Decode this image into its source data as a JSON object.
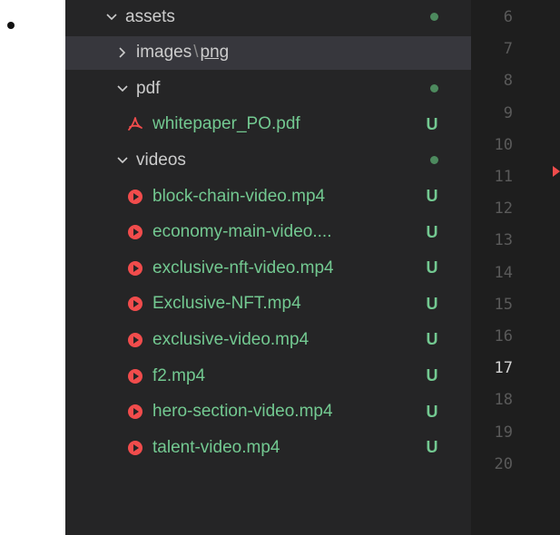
{
  "explorer": {
    "rows": [
      {
        "kind": "folder",
        "label": "assets",
        "expanded": true,
        "status": "dot"
      },
      {
        "kind": "folder",
        "label_parts": [
          "images",
          "png"
        ],
        "expanded": false,
        "selected": true
      },
      {
        "kind": "folder",
        "label": "pdf",
        "expanded": true,
        "status": "dot"
      },
      {
        "kind": "pdf",
        "label": "whitepaper_PO.pdf",
        "status": "U"
      },
      {
        "kind": "folder",
        "label": "videos",
        "expanded": true,
        "status": "dot"
      },
      {
        "kind": "video",
        "label": "block-chain-video.mp4",
        "status": "U"
      },
      {
        "kind": "video",
        "label": "economy-main-video....",
        "status": "U"
      },
      {
        "kind": "video",
        "label": "exclusive-nft-video.mp4",
        "status": "U"
      },
      {
        "kind": "video",
        "label": "Exclusive-NFT.mp4",
        "status": "U"
      },
      {
        "kind": "video",
        "label": "exclusive-video.mp4",
        "status": "U"
      },
      {
        "kind": "video",
        "label": "f2.mp4",
        "status": "U"
      },
      {
        "kind": "video",
        "label": "hero-section-video.mp4",
        "status": "U"
      },
      {
        "kind": "video",
        "label": "talent-video.mp4",
        "status": "U"
      }
    ],
    "icons": {
      "chevron_down": "chevron-down-icon",
      "chevron_right": "chevron-right-icon",
      "pdf": "pdf-icon",
      "video": "video-icon"
    },
    "colors": {
      "untracked": "#73c991",
      "video_icon": "#f14c4c",
      "pdf_icon": "#f14c4c"
    }
  },
  "editor": {
    "line_numbers": [
      "6",
      "7",
      "8",
      "9",
      "10",
      "11",
      "12",
      "13",
      "14",
      "15",
      "16",
      "17",
      "18",
      "19",
      "20"
    ],
    "current_line": "17"
  }
}
